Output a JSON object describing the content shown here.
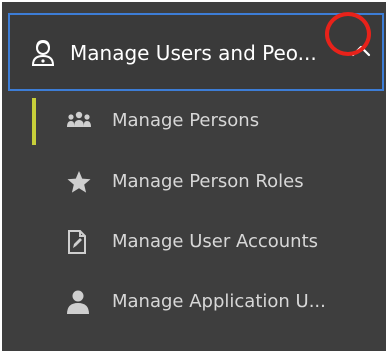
{
  "menu": {
    "header": {
      "title": "Manage Users and Peo...",
      "icon": "user-headset-icon",
      "toggle_icon": "chevron-up-icon",
      "highlight_color": "#e8221a",
      "border_color": "#3d7dd6"
    },
    "active_indicator_color": "#c7cf3a",
    "items": [
      {
        "label": "Manage Persons",
        "icon": "group-icon"
      },
      {
        "label": "Manage Person Roles",
        "icon": "star-icon"
      },
      {
        "label": "Manage User Accounts",
        "icon": "document-edit-icon"
      },
      {
        "label": "Manage Application U...",
        "icon": "user-icon"
      }
    ]
  }
}
